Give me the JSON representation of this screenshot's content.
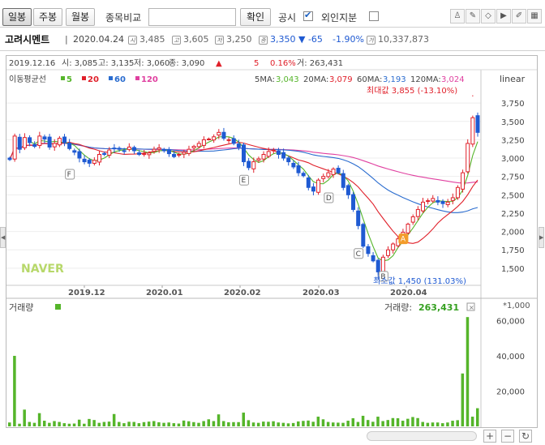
{
  "toolbar": {
    "period_buttons": [
      {
        "label": "일봉",
        "active": true
      },
      {
        "label": "주봉",
        "active": false
      },
      {
        "label": "월봉",
        "active": false
      }
    ],
    "compare_label": "종목비교",
    "compare_placeholder": "",
    "confirm_label": "확인",
    "disclosure_label": "공시",
    "disclosure_checked": true,
    "foreign_label": "외인지분",
    "foreign_checked": false
  },
  "stock": {
    "name": "고려시멘트",
    "date": "2020.04.24",
    "open": "3,485",
    "high": "3,605",
    "low": "3,250",
    "close": "3,350",
    "change": "▼ -65",
    "change_pct": "-1.90%",
    "volume": "10,337,873"
  },
  "cursor_info": {
    "date": "2019.12.16",
    "open": "시: 3,085",
    "high": "고: 3,135",
    "low": "저: 3,060",
    "close": "종: 3,090",
    "arrow": "▲",
    "change": "5",
    "pct": "0.16%",
    "vol": "거: 263,431"
  },
  "ma_legend": {
    "title": "이동평균선",
    "items": [
      {
        "label": "5",
        "color": "#55b52a"
      },
      {
        "label": "20",
        "color": "#e0202a"
      },
      {
        "label": "60",
        "color": "#2a6ccf"
      },
      {
        "label": "120",
        "color": "#e040a0"
      }
    ],
    "values": [
      {
        "label": "5MA:",
        "value": "3,043",
        "color": "#55b52a"
      },
      {
        "label": "20MA:",
        "value": "3,079",
        "color": "#e0202a"
      },
      {
        "label": "60MA:",
        "value": "3,193",
        "color": "#2a6ccf"
      },
      {
        "label": "120MA:",
        "value": "3,024",
        "color": "#e040a0"
      }
    ]
  },
  "scale_label": "linear",
  "watermark": "NAVER",
  "max_label": "최대값 3,855 (-13.10%)",
  "min_label": "최소값 1,450 (131.03%)",
  "markers": {
    "A": "A",
    "B": "B",
    "C": "C",
    "D": "D",
    "E": "E",
    "F": "F"
  },
  "x_labels": [
    "2019.12",
    "2020.01",
    "2020.02",
    "2020.03",
    "2020.04"
  ],
  "y_labels": [
    "3,750",
    "3,500",
    "3,250",
    "3,000",
    "2,750",
    "2,500",
    "2,250",
    "2,000",
    "1,750",
    "1,500"
  ],
  "volume_panel": {
    "title": "거래량",
    "cursor_label": "거래량:",
    "cursor_value": "263,431",
    "unit": "*1,000",
    "y_labels": [
      "60,000",
      "40,000",
      "20,000"
    ]
  },
  "chart_data": [
    {
      "type": "candlestick",
      "title": "",
      "ylim": [
        1300,
        3950
      ],
      "x": [
        "2019.12",
        "2020.01",
        "2020.02",
        "2020.03",
        "2020.04"
      ],
      "close": [
        2980,
        3300,
        3120,
        3280,
        3210,
        3160,
        3300,
        3260,
        3150,
        3200,
        3270,
        3210,
        3130,
        3080,
        3000,
        2950,
        2930,
        2970,
        3050,
        3050,
        3110,
        3130,
        3120,
        3100,
        3150,
        3100,
        3050,
        3060,
        3070,
        3120,
        3140,
        3100,
        3060,
        3020,
        3050,
        3080,
        3120,
        3160,
        3200,
        3250,
        3260,
        3290,
        3350,
        3270,
        3250,
        3200,
        3150,
        2950,
        2870,
        2950,
        2990,
        3050,
        3090,
        3110,
        3050,
        3000,
        2950,
        2880,
        2800,
        2760,
        2600,
        2550,
        2700,
        2750,
        2800,
        2850,
        2800,
        2600,
        2500,
        2300,
        2080,
        1800,
        1700,
        1600,
        1450,
        1650,
        1750,
        1830,
        1900,
        1990,
        2100,
        2200,
        2300,
        2400,
        2420,
        2450,
        2400,
        2380,
        2400,
        2460,
        2600,
        2800,
        3200,
        3550,
        3350
      ],
      "volume_k": [
        2200,
        40000,
        1500,
        9500,
        2500,
        2000,
        7500,
        3200,
        2000,
        3000,
        2500,
        1800,
        1500,
        1600,
        3800,
        1500,
        4200,
        3600,
        2000,
        2500,
        2700,
        7000,
        2500,
        1800,
        2600,
        2500,
        1800,
        2400,
        2700,
        3000,
        2300,
        2000,
        2200,
        1800,
        1600,
        3300,
        2900,
        2400,
        2000,
        3000,
        4000,
        3000,
        6800,
        3000,
        2300,
        2400,
        2400,
        7800,
        3500,
        2200,
        2000,
        2700,
        2600,
        2900,
        2200,
        2000,
        1700,
        1900,
        2800,
        3100,
        3300,
        2600,
        5500,
        4000,
        2500,
        2200,
        2100,
        2000,
        3200,
        4600,
        2500,
        6000,
        3600,
        2600,
        5500,
        3000,
        3600,
        4700,
        4600,
        3200,
        4300,
        5300,
        4700,
        2500,
        2000,
        2200,
        2200,
        1800,
        2200,
        3200,
        3500,
        30000,
        62000,
        5500,
        10300
      ]
    }
  ]
}
